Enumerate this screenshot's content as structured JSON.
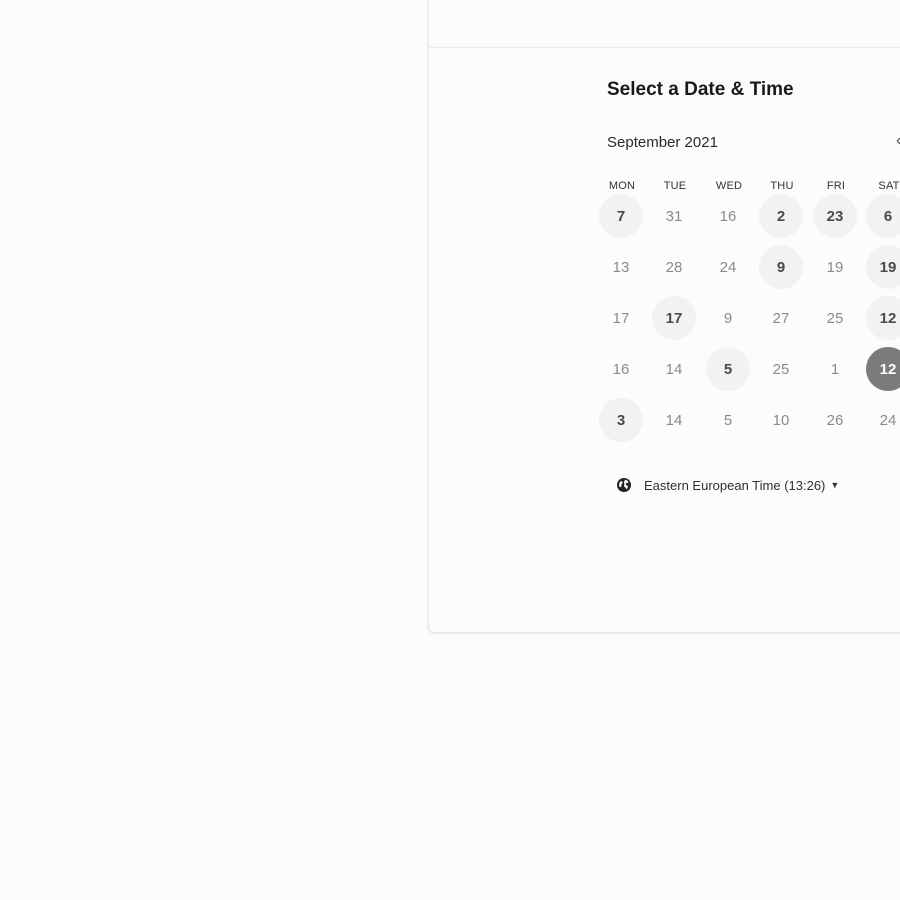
{
  "scheduler": {
    "title": "Select a Date & Time",
    "month_label": "September 2021",
    "prev_icon": "chevron-left-icon",
    "day_names": [
      "MON",
      "TUE",
      "WED",
      "THU",
      "FRI",
      "SAT"
    ],
    "weeks": [
      [
        {
          "label": "7",
          "state": "available"
        },
        {
          "label": "31",
          "state": "unavailable"
        },
        {
          "label": "16",
          "state": "unavailable"
        },
        {
          "label": "2",
          "state": "available"
        },
        {
          "label": "23",
          "state": "available"
        },
        {
          "label": "6",
          "state": "available"
        }
      ],
      [
        {
          "label": "13",
          "state": "unavailable"
        },
        {
          "label": "28",
          "state": "unavailable"
        },
        {
          "label": "24",
          "state": "unavailable"
        },
        {
          "label": "9",
          "state": "available"
        },
        {
          "label": "19",
          "state": "unavailable"
        },
        {
          "label": "19",
          "state": "available"
        }
      ],
      [
        {
          "label": "17",
          "state": "unavailable"
        },
        {
          "label": "17",
          "state": "available"
        },
        {
          "label": "9",
          "state": "unavailable"
        },
        {
          "label": "27",
          "state": "unavailable"
        },
        {
          "label": "25",
          "state": "unavailable"
        },
        {
          "label": "12",
          "state": "available"
        }
      ],
      [
        {
          "label": "16",
          "state": "unavailable"
        },
        {
          "label": "14",
          "state": "unavailable"
        },
        {
          "label": "5",
          "state": "available"
        },
        {
          "label": "25",
          "state": "unavailable"
        },
        {
          "label": "1",
          "state": "unavailable"
        },
        {
          "label": "12",
          "state": "selected"
        }
      ],
      [
        {
          "label": "3",
          "state": "available"
        },
        {
          "label": "14",
          "state": "unavailable"
        },
        {
          "label": "5",
          "state": "unavailable"
        },
        {
          "label": "10",
          "state": "unavailable"
        },
        {
          "label": "26",
          "state": "unavailable"
        },
        {
          "label": "24",
          "state": "unavailable"
        }
      ]
    ],
    "timezone": {
      "icon": "globe-icon",
      "label": "Eastern European Time (13:26)",
      "dropdown_icon": "caret-down-icon"
    },
    "colors": {
      "available_bg": "#f2f2f2",
      "selected_bg": "#7b7b7b",
      "unavailable_text": "#8a8a8a"
    }
  }
}
